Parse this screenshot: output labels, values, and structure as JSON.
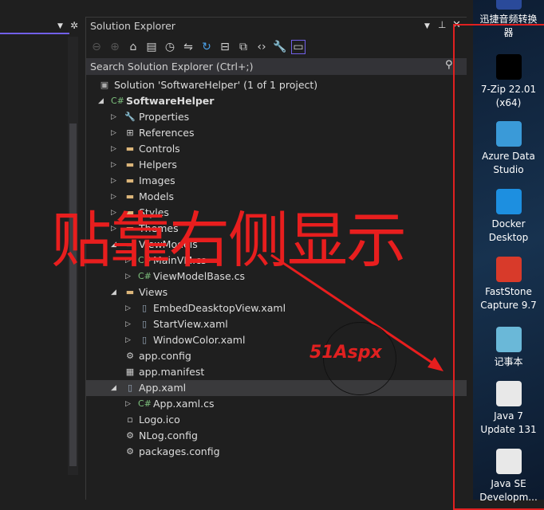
{
  "panel": {
    "title": "Solution Explorer",
    "search_placeholder": "Search Solution Explorer (Ctrl+;)",
    "toolbar_icons": [
      "back-icon",
      "forward-icon",
      "home-icon",
      "vs-solution-icon",
      "history-icon",
      "sync-icon",
      "refresh-icon",
      "collapse-icon",
      "copy-icon",
      "code-icon",
      "wrench-icon",
      "preview-icon"
    ]
  },
  "tree": [
    {
      "label": "Solution 'SoftwareHelper' (1 of 1 project)",
      "level": 0,
      "icon": "solution",
      "state": "none"
    },
    {
      "label": "SoftwareHelper",
      "level": 1,
      "icon": "csproj",
      "state": "open",
      "bold": true
    },
    {
      "label": "Properties",
      "level": 2,
      "icon": "wrench",
      "state": "closed"
    },
    {
      "label": "References",
      "level": 2,
      "icon": "references",
      "state": "closed"
    },
    {
      "label": "Controls",
      "level": 2,
      "icon": "folder",
      "state": "closed"
    },
    {
      "label": "Helpers",
      "level": 2,
      "icon": "folder",
      "state": "closed"
    },
    {
      "label": "Images",
      "level": 2,
      "icon": "folder",
      "state": "closed"
    },
    {
      "label": "Models",
      "level": 2,
      "icon": "folder",
      "state": "closed"
    },
    {
      "label": "Styles",
      "level": 2,
      "icon": "folder",
      "state": "closed"
    },
    {
      "label": "Themes",
      "level": 2,
      "icon": "folder",
      "state": "closed"
    },
    {
      "label": "ViewModels",
      "level": 2,
      "icon": "folder",
      "state": "open"
    },
    {
      "label": "MainVM.cs",
      "level": 3,
      "icon": "cs",
      "state": "closed"
    },
    {
      "label": "ViewModelBase.cs",
      "level": 3,
      "icon": "cs",
      "state": "closed"
    },
    {
      "label": "Views",
      "level": 2,
      "icon": "folder",
      "state": "open"
    },
    {
      "label": "EmbedDeasktopView.xaml",
      "level": 3,
      "icon": "xaml",
      "state": "closed"
    },
    {
      "label": "StartView.xaml",
      "level": 3,
      "icon": "xaml",
      "state": "closed"
    },
    {
      "label": "WindowColor.xaml",
      "level": 3,
      "icon": "xaml",
      "state": "closed"
    },
    {
      "label": "app.config",
      "level": 2,
      "icon": "config",
      "state": "none"
    },
    {
      "label": "app.manifest",
      "level": 2,
      "icon": "manifest",
      "state": "none"
    },
    {
      "label": "App.xaml",
      "level": 2,
      "icon": "xaml",
      "state": "open",
      "selected": true
    },
    {
      "label": "App.xaml.cs",
      "level": 3,
      "icon": "cs",
      "state": "closed"
    },
    {
      "label": "Logo.ico",
      "level": 2,
      "icon": "image",
      "state": "none"
    },
    {
      "label": "NLog.config",
      "level": 2,
      "icon": "config",
      "state": "none"
    },
    {
      "label": "packages.config",
      "level": 2,
      "icon": "config",
      "state": "none"
    }
  ],
  "desktop": [
    {
      "label": "迅捷音频转换器",
      "color": "#2a4a9a"
    },
    {
      "label": "7-Zip 22.01 (x64)",
      "color": "#000000"
    },
    {
      "label": "Azure Data Studio",
      "color": "#3a9ad8"
    },
    {
      "label": "Docker Desktop",
      "color": "#1d8fe0"
    },
    {
      "label": "FastStone Capture 9.7",
      "color": "#d83a2a"
    },
    {
      "label": "记事本",
      "color": "#6ab8d8"
    },
    {
      "label": "Java 7 Update 131",
      "color": "#e8e8e8"
    },
    {
      "label": "Java SE Developm...",
      "color": "#e8e8e8"
    }
  ],
  "annotation": {
    "text": "贴靠右侧显示",
    "color": "#e81e1e"
  },
  "watermark": {
    "text": "51Aspx"
  },
  "colors": {
    "accent": "#7160e8",
    "selection": "#3a3a3c",
    "annotation": "#e81e1e"
  }
}
